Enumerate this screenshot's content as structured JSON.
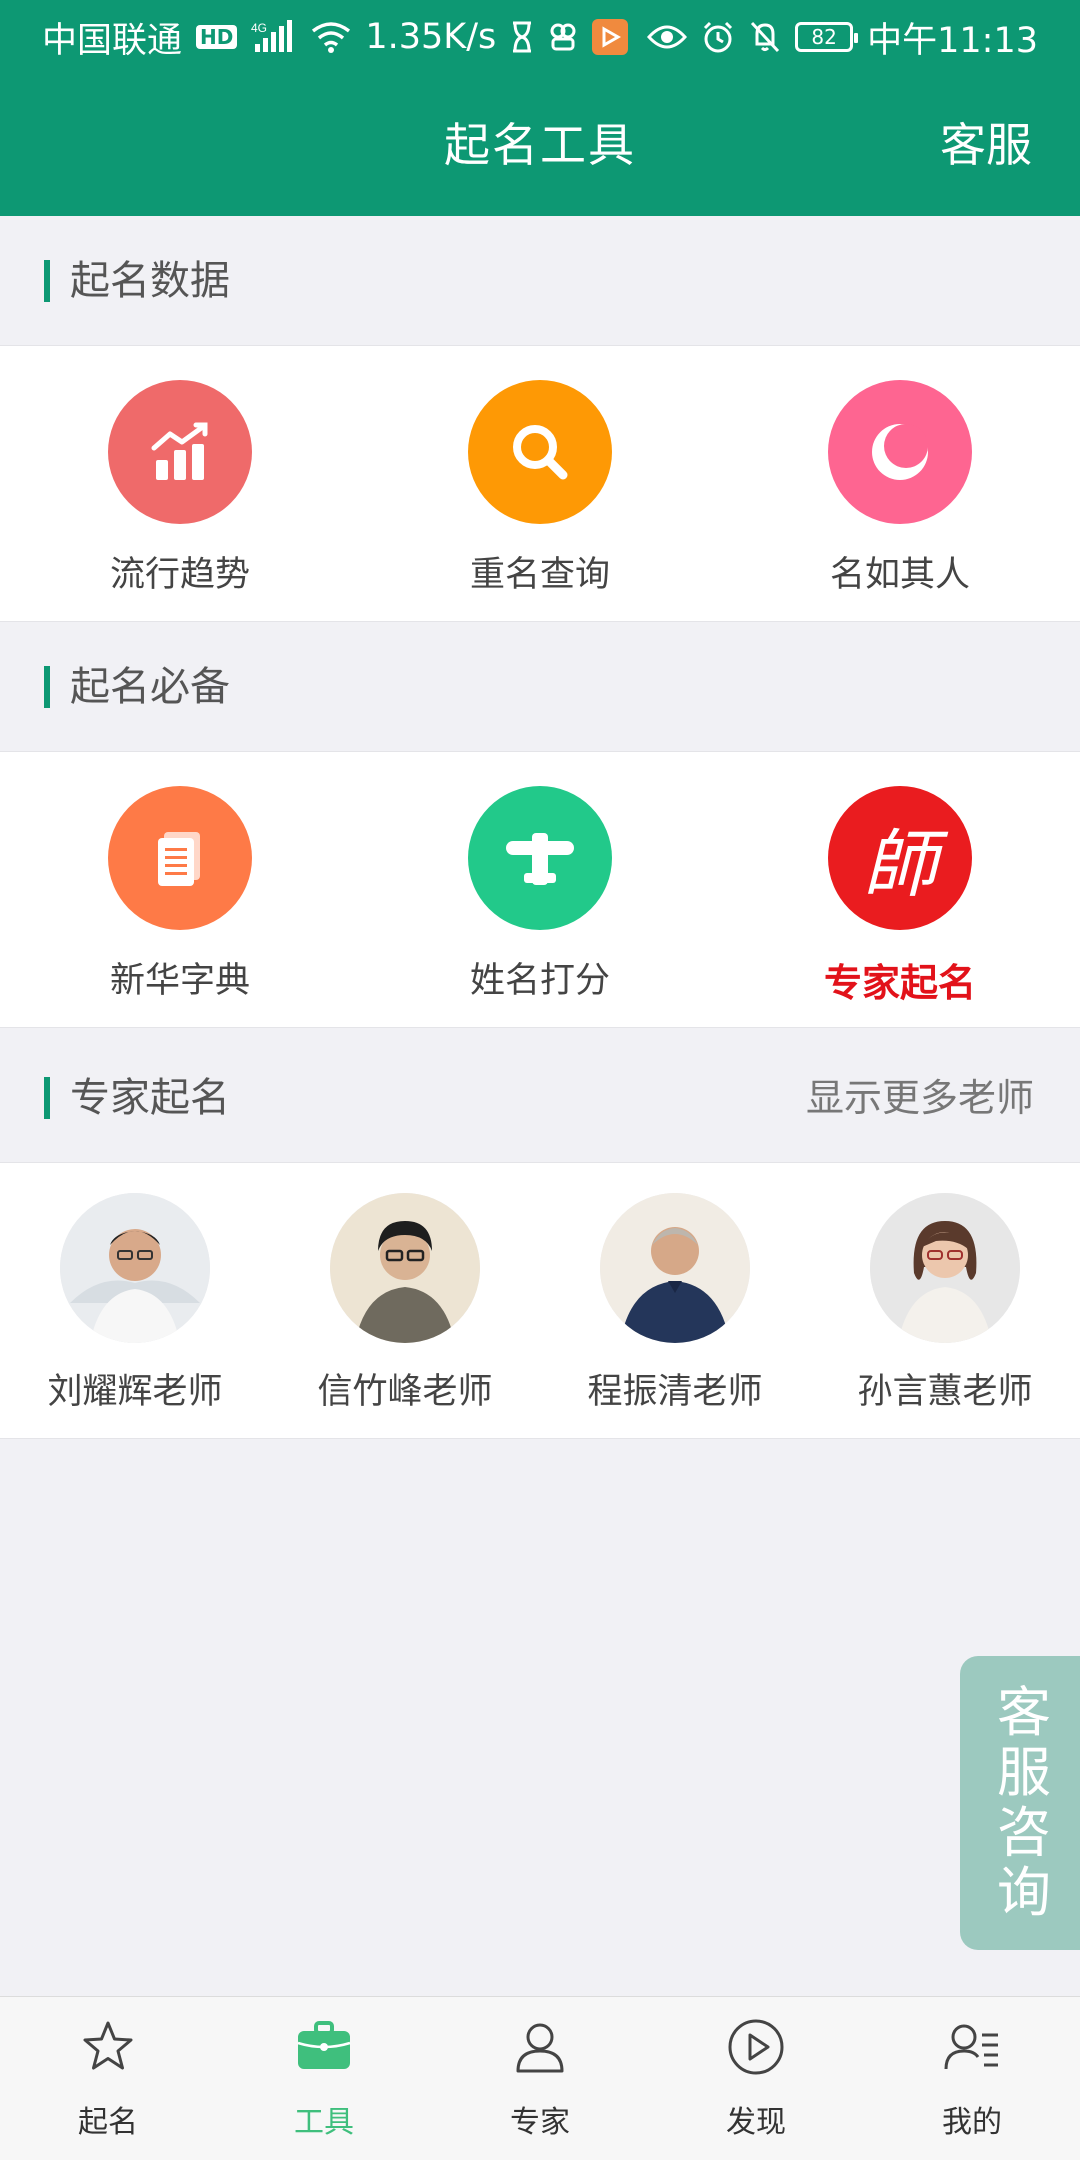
{
  "status_bar": {
    "carrier": "中国联通",
    "hd": "HD",
    "network": "4G",
    "speed": "1.35K/s",
    "battery": "82",
    "time": "中午11:13"
  },
  "header": {
    "title": "起名工具",
    "service": "客服"
  },
  "sections": {
    "data": {
      "title": "起名数据",
      "items": [
        {
          "label": "流行趋势",
          "icon": "trend-chart-icon",
          "color": "#ef6a6a"
        },
        {
          "label": "重名查询",
          "icon": "search-icon",
          "color": "#fe9905"
        },
        {
          "label": "名如其人",
          "icon": "crescent-icon",
          "color": "#fe6591"
        }
      ]
    },
    "essentials": {
      "title": "起名必备",
      "items": [
        {
          "label": "新华字典",
          "icon": "dictionary-icon",
          "color": "#fe7a47"
        },
        {
          "label": "姓名打分",
          "icon": "score-icon",
          "color": "#22c98a"
        },
        {
          "label": "专家起名",
          "icon": "master-seal-icon",
          "color": "#ea1c1f",
          "glyph": "師"
        }
      ]
    },
    "experts": {
      "title": "专家起名",
      "more": "显示更多老师",
      "items": [
        {
          "name": "刘耀辉老师"
        },
        {
          "name": "信竹峰老师"
        },
        {
          "name": "程振清老师"
        },
        {
          "name": "孙言蕙老师"
        }
      ]
    }
  },
  "consult": "客服咨询",
  "bottom_nav": [
    {
      "label": "起名",
      "icon": "star-icon",
      "active": false
    },
    {
      "label": "工具",
      "icon": "briefcase-icon",
      "active": true
    },
    {
      "label": "专家",
      "icon": "person-icon",
      "active": false
    },
    {
      "label": "发现",
      "icon": "play-icon",
      "active": false
    },
    {
      "label": "我的",
      "icon": "profile-list-icon",
      "active": false
    }
  ],
  "colors": {
    "brand": "#0d9873",
    "nav_active": "#3fbf7d",
    "highlight_red": "#e2121a"
  }
}
